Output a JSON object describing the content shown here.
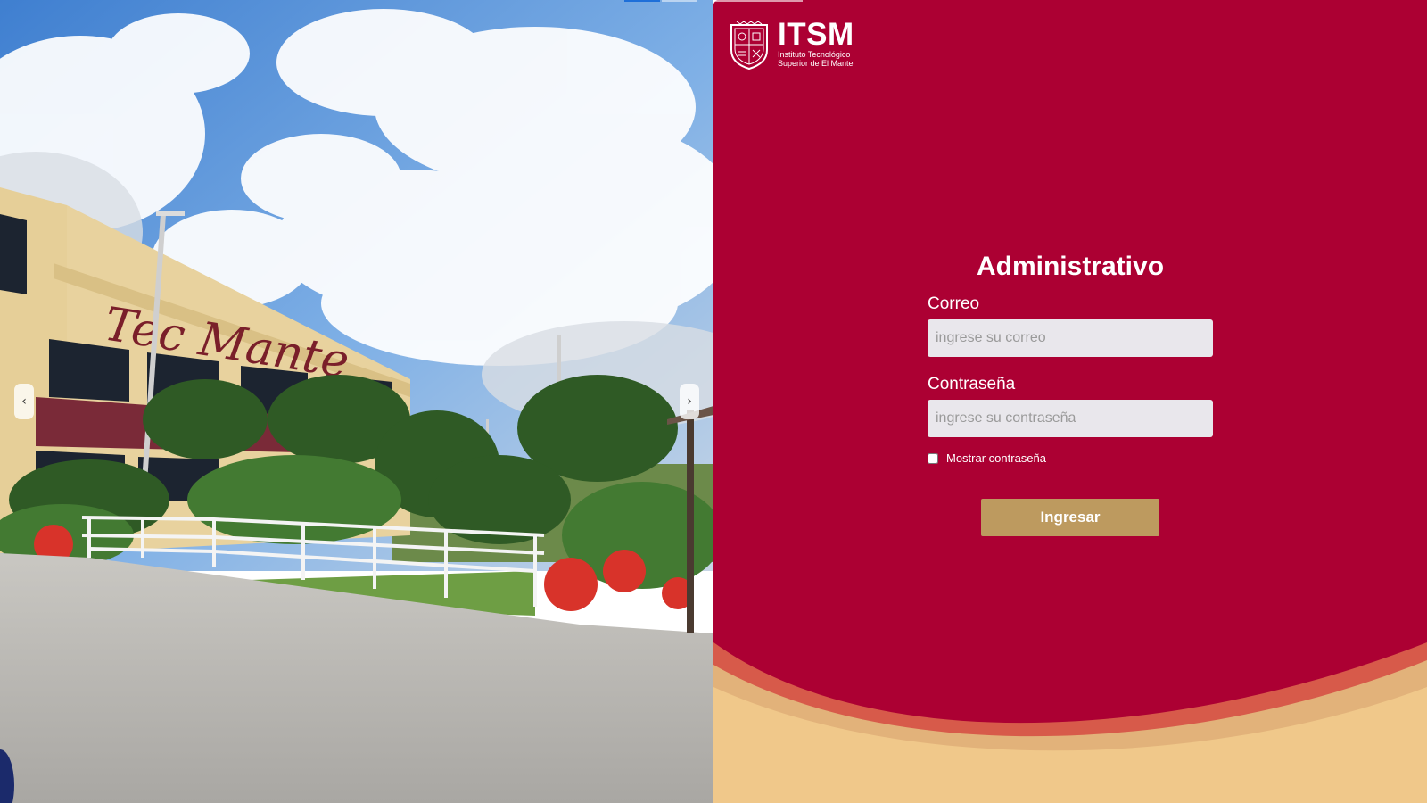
{
  "carousel": {
    "prev_icon": "chevron-left-icon",
    "prev_glyph": "‹",
    "next_icon": "chevron-right-icon",
    "next_glyph": "›",
    "sign_text": "Tec Mante"
  },
  "brand": {
    "logo_icon": "university-crest-icon",
    "name": "ITSM",
    "subtitle_line1": "Instituto Tecnológico",
    "subtitle_line2": "Superior de El Mante"
  },
  "login": {
    "title": "Administrativo",
    "email_label": "Correo",
    "email_placeholder": "ingrese su correo",
    "email_value": "",
    "password_label": "Contraseña",
    "password_placeholder": "ingrese su contraseña",
    "password_value": "",
    "show_password_label": "Mostrar contraseña",
    "show_password_checked": false,
    "submit_label": "Ingresar"
  },
  "colors": {
    "panel_bg": "#ac0033",
    "wave_orange": "#d75a4a",
    "wave_tan": "#e2b27a",
    "wave_cream": "#f0c88a",
    "input_bg": "#e9e7ec",
    "button_bg": "#bd9a5f"
  }
}
